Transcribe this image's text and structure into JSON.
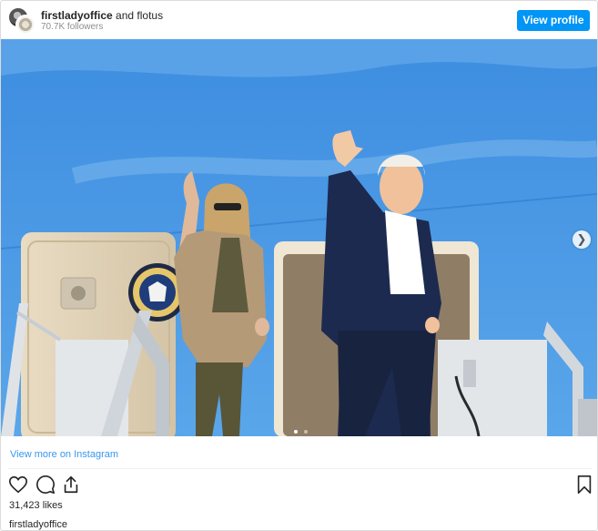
{
  "header": {
    "account1": "firstladyoffice",
    "connector": "and",
    "account2": "flotus",
    "followers": "70.7K followers",
    "view_profile_label": "View profile"
  },
  "post": {
    "photo_alt": "Photo: couple waving on aircraft stairs",
    "next_icon": "chevron-right-icon",
    "carousel_position": 1,
    "carousel_total": 2
  },
  "footer": {
    "view_more_label": "View more on Instagram",
    "likes": "31,423 likes",
    "owner": "firstladyoffice"
  },
  "colors": {
    "accent": "#0095f6",
    "link": "#3897f0"
  }
}
